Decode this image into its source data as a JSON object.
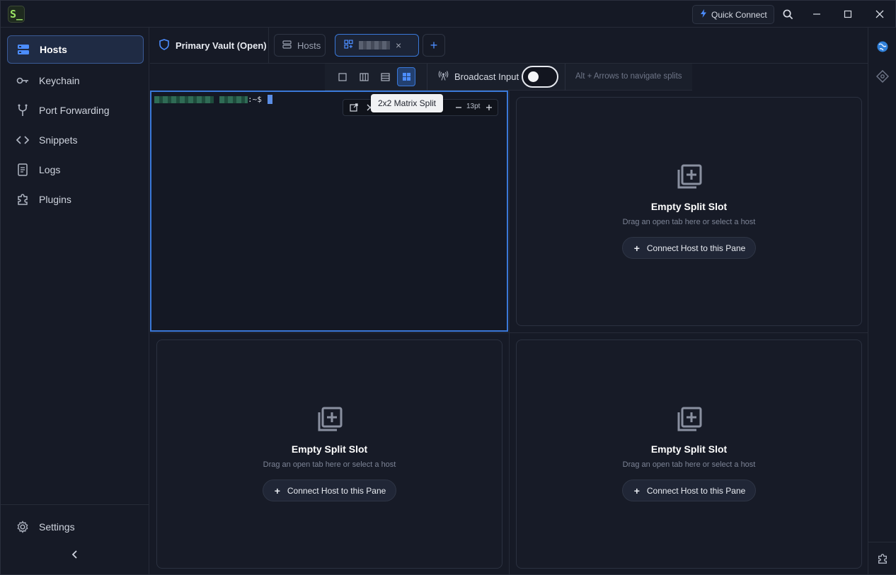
{
  "app": {
    "logo_text": "S_",
    "quick_connect_label": "Quick Connect"
  },
  "sidebar": {
    "items": [
      {
        "label": "Hosts",
        "icon": "hosts-icon",
        "active": true
      },
      {
        "label": "Keychain",
        "icon": "key-icon"
      },
      {
        "label": "Port Forwarding",
        "icon": "fork-icon"
      },
      {
        "label": "Snippets",
        "icon": "code-icon"
      },
      {
        "label": "Logs",
        "icon": "logs-icon"
      },
      {
        "label": "Plugins",
        "icon": "puzzle-icon"
      }
    ],
    "settings_label": "Settings"
  },
  "tabs": {
    "vault_label": "Primary Vault (Open)",
    "hosts_tab_label": "Hosts",
    "split_tab_close": "×",
    "add_tab": "+"
  },
  "split_toolbar": {
    "broadcast_label": "Broadcast Input",
    "broadcast_enabled": false,
    "hint": "Alt + Arrows to navigate splits",
    "tooltip": "2x2 Matrix Split",
    "active_layout": "2x2"
  },
  "terminal": {
    "prompt_suffix": ":~$",
    "font_size": "13pt"
  },
  "empty_slot": {
    "title": "Empty Split Slot",
    "subtitle": "Drag an open tab here or select a host",
    "button": "Connect Host to this Pane"
  },
  "colors": {
    "accent": "#3a78d8",
    "background": "#161a26",
    "terminal_bg": "#141824"
  }
}
